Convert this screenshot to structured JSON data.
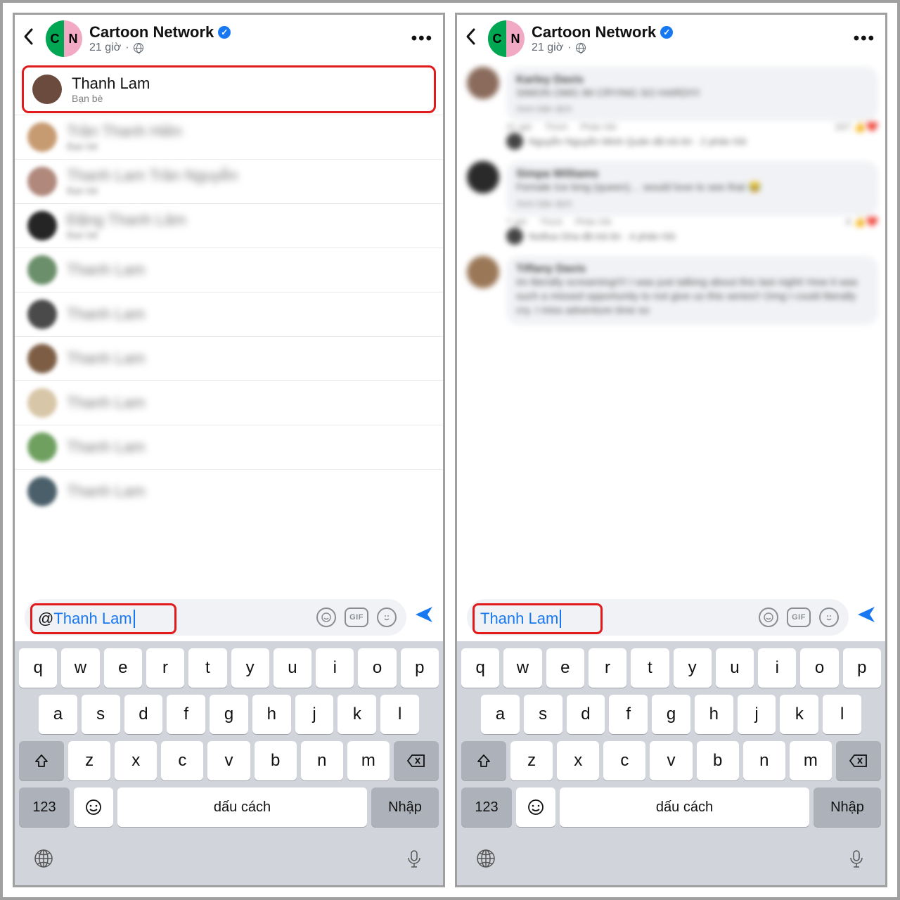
{
  "page": {
    "name": "Cartoon Network",
    "timestamp": "21 giờ",
    "logo_left": "C",
    "logo_right": "N"
  },
  "left": {
    "input_text": "@Thanh Lam",
    "at": "@",
    "input_name": "Thanh Lam",
    "suggestions": [
      {
        "name": "Thanh Lam",
        "rel": "Bạn bè",
        "blur": false
      },
      {
        "name": "Trần Thanh Hiền",
        "rel": "Bạn bè",
        "blur": true
      },
      {
        "name": "Thanh Lam Trần Nguyễn",
        "rel": "Bạn bè",
        "blur": true
      },
      {
        "name": "Đặng Thanh Lâm",
        "rel": "Bạn bè",
        "blur": true
      },
      {
        "name": "Thanh Lam",
        "rel": "",
        "blur": true
      },
      {
        "name": "Thanh Lam",
        "rel": "",
        "blur": true
      },
      {
        "name": "Thanh Lam",
        "rel": "",
        "blur": true
      },
      {
        "name": "Thanh Lam",
        "rel": "",
        "blur": true
      },
      {
        "name": "Thanh Lam",
        "rel": "",
        "blur": true
      },
      {
        "name": "Thanh Lam",
        "rel": "",
        "blur": true
      }
    ]
  },
  "right": {
    "input_text": "Thanh Lam",
    "comments": [
      {
        "name": "Karley Davis",
        "text": "SIMON OMG IM CRYING SO HARD!!!!",
        "translate": "Xem bản dịch",
        "meta": {
          "time": "21 giờ",
          "like": "Thích",
          "reply": "Phản hồi",
          "reacts": "167"
        },
        "reply_line": "Nguyễn Nguyễn Minh Quân đã trả lời · 2 phản hồi"
      },
      {
        "name": "Simpa Williams",
        "text": "Female Ice king (queen)… would love to see that 😂",
        "translate": "Xem bản dịch",
        "meta": {
          "time": "7 giờ",
          "like": "Thích",
          "reply": "Phản hồi",
          "reacts": "4"
        },
        "reply_line": "Notfua Gha đã trả lời · 4 phản hồi"
      },
      {
        "name": "Tiffany Davis",
        "text": "Im literally screaming!!!! I was just talking about this last night! How it was such a missed opportunity to not give us this series!! Omg I could literally cry. I miss adventure time so",
        "translate": "",
        "meta": {
          "time": "",
          "like": "",
          "reply": "",
          "reacts": ""
        },
        "reply_line": ""
      }
    ]
  },
  "input_icons": {
    "gif": "GIF"
  },
  "keyboard": {
    "row1": [
      "q",
      "w",
      "e",
      "r",
      "t",
      "y",
      "u",
      "i",
      "o",
      "p"
    ],
    "row2": [
      "a",
      "s",
      "d",
      "f",
      "g",
      "h",
      "j",
      "k",
      "l"
    ],
    "row3": [
      "z",
      "x",
      "c",
      "v",
      "b",
      "n",
      "m"
    ],
    "k123": "123",
    "space": "dấu cách",
    "enter": "Nhập"
  }
}
